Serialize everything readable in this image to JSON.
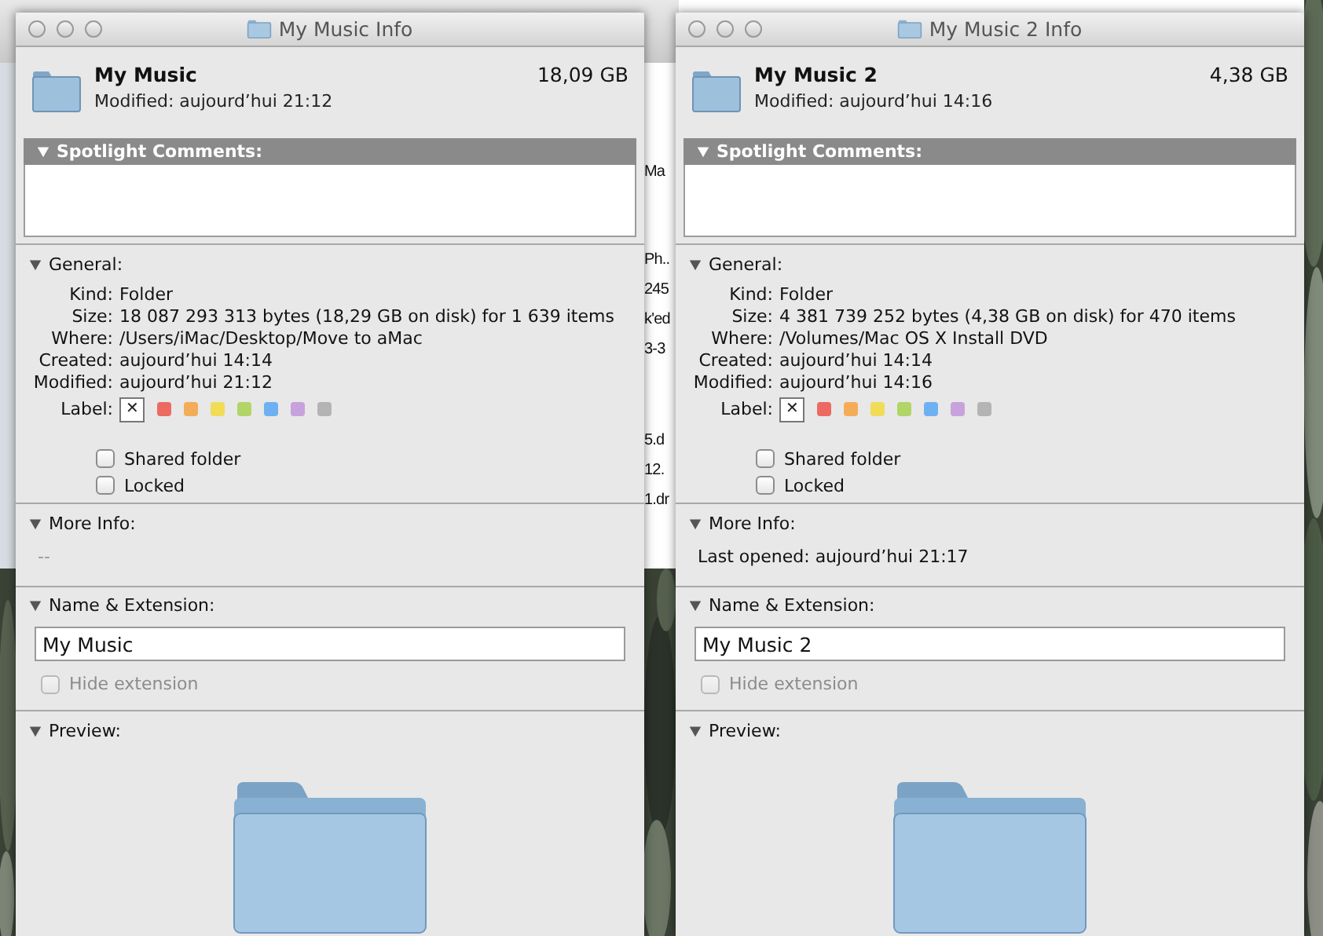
{
  "background_window": {
    "fragments": [
      "Ma",
      "Ph..",
      "245",
      "k'ed",
      "3-3",
      "5.d",
      "12.",
      "1.dr"
    ]
  },
  "windows": [
    {
      "title": "My Music Info",
      "name": "My Music",
      "size": "18,09 GB",
      "modified": "Modified: aujourd’hui 21:12",
      "spotlight": {
        "title": "Spotlight Comments:",
        "expanded": true
      },
      "general": {
        "title": "General:",
        "expanded": true,
        "rows": [
          {
            "label": "Kind:",
            "value": "Folder"
          },
          {
            "label": "Size:",
            "value": "18 087 293 313 bytes (18,29 GB on disk) for 1 639 items"
          },
          {
            "label": "Where:",
            "value": "/Users/iMac/Desktop/Move to aMac"
          },
          {
            "label": "Created:",
            "value": "aujourd’hui 14:14"
          },
          {
            "label": "Modified:",
            "value": "aujourd’hui 21:12"
          }
        ],
        "label_title": "Label:",
        "label_options": [
          {
            "kind": "none",
            "glyph": "✕",
            "selected": true
          },
          {
            "kind": "color",
            "color": "#ec6a62",
            "selected": false
          },
          {
            "kind": "color",
            "color": "#f5ac58",
            "selected": false
          },
          {
            "kind": "color",
            "color": "#f1dc57",
            "selected": false
          },
          {
            "kind": "color",
            "color": "#b2d568",
            "selected": false
          },
          {
            "kind": "color",
            "color": "#6db1f2",
            "selected": false
          },
          {
            "kind": "color",
            "color": "#c8a2dc",
            "selected": false
          },
          {
            "kind": "color",
            "color": "#b4b4b4",
            "selected": false
          }
        ],
        "checkboxes": [
          {
            "label": "Shared folder",
            "checked": false
          },
          {
            "label": "Locked",
            "checked": false
          }
        ]
      },
      "more_info": {
        "title": "More Info:",
        "expanded": true,
        "text": "--",
        "empty": true
      },
      "name_ext": {
        "title": "Name & Extension:",
        "expanded": true,
        "value": "My Music",
        "hide_extension": {
          "label": "Hide extension",
          "checked": false,
          "disabled": true
        }
      },
      "preview": {
        "title": "Preview:",
        "expanded": true
      }
    },
    {
      "title": "My Music 2 Info",
      "name": "My Music 2",
      "size": "4,38 GB",
      "modified": "Modified: aujourd’hui 14:16",
      "spotlight": {
        "title": "Spotlight Comments:",
        "expanded": true
      },
      "general": {
        "title": "General:",
        "expanded": true,
        "rows": [
          {
            "label": "Kind:",
            "value": "Folder"
          },
          {
            "label": "Size:",
            "value": "4 381 739 252 bytes (4,38 GB on disk) for 470 items"
          },
          {
            "label": "Where:",
            "value": "/Volumes/Mac OS X Install DVD"
          },
          {
            "label": "Created:",
            "value": "aujourd’hui 14:14"
          },
          {
            "label": "Modified:",
            "value": "aujourd’hui 14:16"
          }
        ],
        "label_title": "Label:",
        "label_options": [
          {
            "kind": "none",
            "glyph": "✕",
            "selected": true
          },
          {
            "kind": "color",
            "color": "#ec6a62",
            "selected": false
          },
          {
            "kind": "color",
            "color": "#f5ac58",
            "selected": false
          },
          {
            "kind": "color",
            "color": "#f1dc57",
            "selected": false
          },
          {
            "kind": "color",
            "color": "#b2d568",
            "selected": false
          },
          {
            "kind": "color",
            "color": "#6db1f2",
            "selected": false
          },
          {
            "kind": "color",
            "color": "#c8a2dc",
            "selected": false
          },
          {
            "kind": "color",
            "color": "#b4b4b4",
            "selected": false
          }
        ],
        "checkboxes": [
          {
            "label": "Shared folder",
            "checked": false
          },
          {
            "label": "Locked",
            "checked": false
          }
        ]
      },
      "more_info": {
        "title": "More Info:",
        "expanded": true,
        "text": "Last opened: aujourd’hui 21:17",
        "empty": false
      },
      "name_ext": {
        "title": "Name & Extension:",
        "expanded": true,
        "value": "My Music 2",
        "hide_extension": {
          "label": "Hide extension",
          "checked": false,
          "disabled": true
        }
      },
      "preview": {
        "title": "Preview:",
        "expanded": true
      }
    }
  ]
}
